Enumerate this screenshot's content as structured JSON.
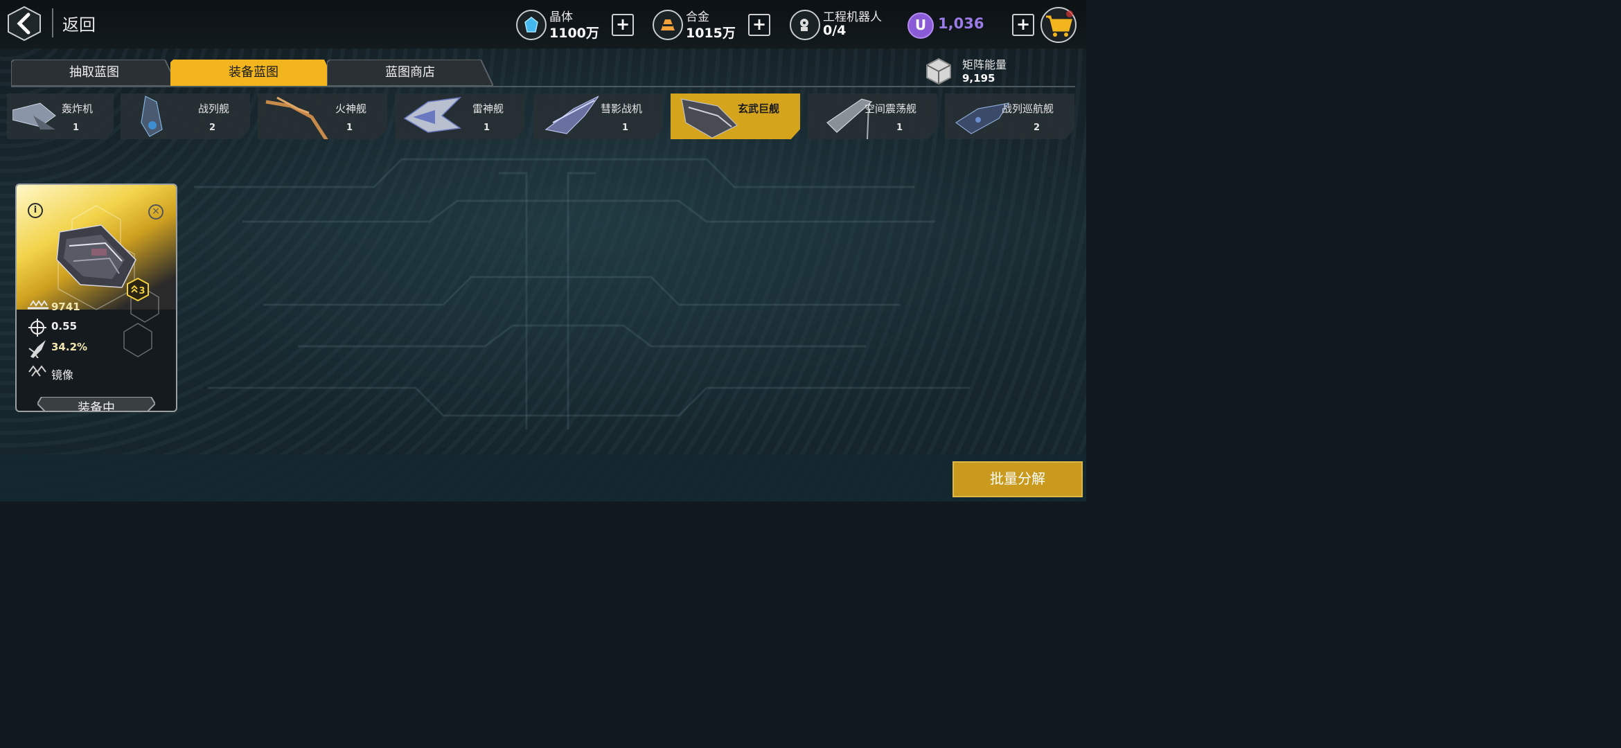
{
  "header": {
    "back_label": "返回",
    "resources": [
      {
        "name": "晶体",
        "value": "1100万",
        "icon": "crystal-icon"
      },
      {
        "name": "合金",
        "value": "1015万",
        "icon": "alloy-icon"
      },
      {
        "name": "工程机器人",
        "value": "0/4",
        "icon": "robot-icon"
      }
    ],
    "premium": {
      "symbol": "U",
      "value": "1,036"
    }
  },
  "tabs": [
    {
      "label": "抽取蓝图",
      "active": false
    },
    {
      "label": "装备蓝图",
      "active": true
    },
    {
      "label": "蓝图商店",
      "active": false
    }
  ],
  "matrix": {
    "name": "矩阵能量",
    "value": "9,195"
  },
  "ships": [
    {
      "name": "轰炸机",
      "count": "1",
      "active": false
    },
    {
      "name": "战列舰",
      "count": "2",
      "active": false
    },
    {
      "name": "火神舰",
      "count": "1",
      "active": false
    },
    {
      "name": "雷神舰",
      "count": "1",
      "active": false
    },
    {
      "name": "彗影战机",
      "count": "1",
      "active": false
    },
    {
      "name": "玄武巨舰",
      "count": "",
      "active": true
    },
    {
      "name": "空间震荡舰",
      "count": "1",
      "active": false
    },
    {
      "name": "战列巡航舰",
      "count": "2",
      "active": false
    }
  ],
  "blueprint": {
    "rank": "3",
    "attack": "9741",
    "accuracy": "0.55",
    "crit": "34.2%",
    "skill": "镜像",
    "status": "装备中"
  },
  "actions": {
    "decompose": "批量分解"
  },
  "colors": {
    "accent": "#d3a41c",
    "premium": "#9b7be6"
  }
}
